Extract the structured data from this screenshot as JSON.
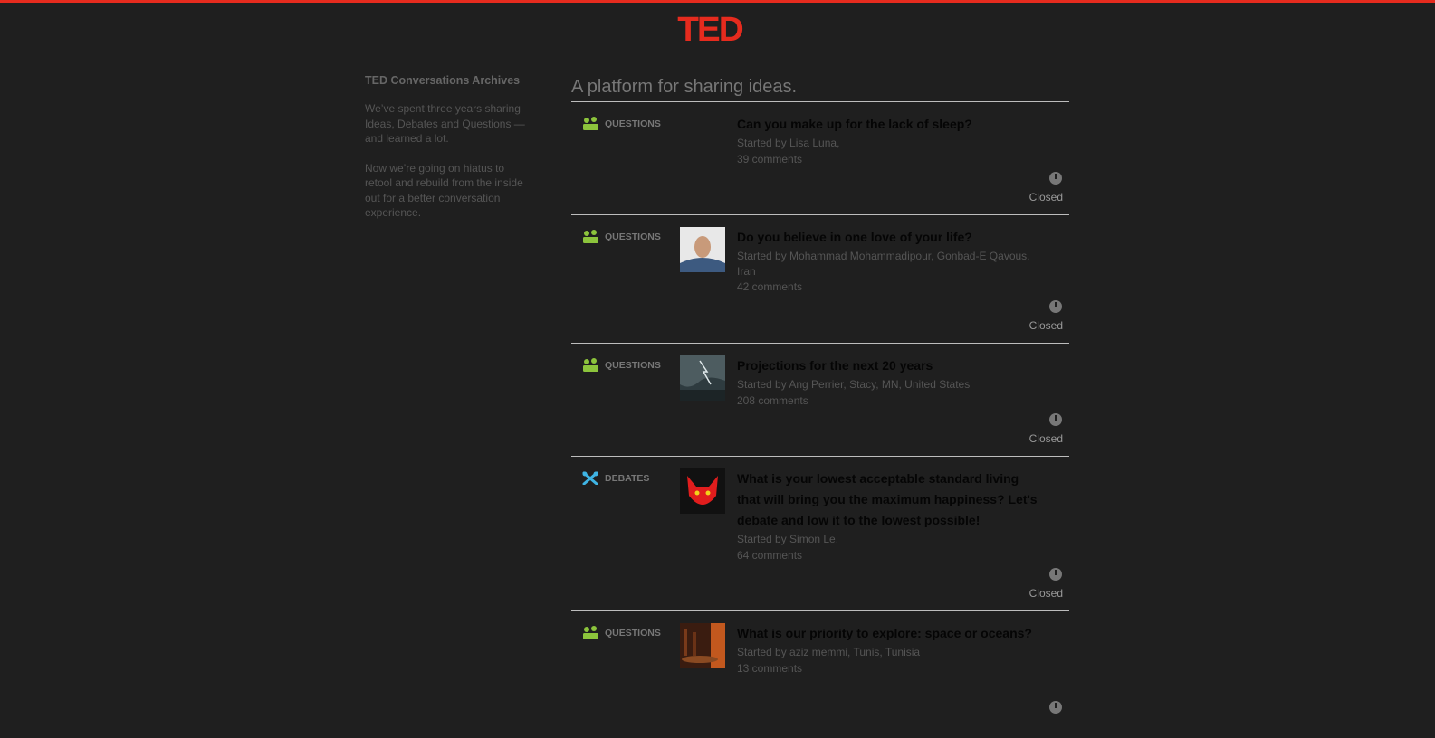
{
  "header": {
    "logo_text": "TED",
    "accent_color": "#e62b1e"
  },
  "sidebar": {
    "title": "TED Conversations Archives",
    "paragraphs": [
      "We’ve spent three years sharing Ideas, Debates and Questions — and learned a lot.",
      "Now we’re going on hiatus to retool and rebuild from the inside out for a better conversation experience."
    ]
  },
  "main": {
    "tagline": "A platform for sharing ideas.",
    "items": [
      {
        "type": "QUESTIONS",
        "icon": "questions-icon",
        "title": "Can you make up for the lack of sleep?",
        "started_by": "Started by Lisa Luna,",
        "comments": "39 comments",
        "status": "Closed"
      },
      {
        "type": "QUESTIONS",
        "icon": "questions-icon",
        "title": "Do you believe in one love of your life?",
        "started_by": "Started by Mohammad Mohammadipour, Gonbad-E Qavous, Iran",
        "comments": "42 comments",
        "status": "Closed"
      },
      {
        "type": "QUESTIONS",
        "icon": "questions-icon",
        "title": "Projections for the next 20 years",
        "started_by": "Started by Ang Perrier, Stacy, MN, United States",
        "comments": "208 comments",
        "status": "Closed"
      },
      {
        "type": "DEBATES",
        "icon": "debates-icon",
        "title": "What is your lowest acceptable standard living that will bring you the maximum happiness? Let's debate and low it to the lowest possible!",
        "started_by": "Started by Simon Le,",
        "comments": "64 comments",
        "status": "Closed"
      },
      {
        "type": "QUESTIONS",
        "icon": "questions-icon",
        "title": "What is our priority to explore: space or oceans?",
        "started_by": "Started by aziz memmi, Tunis, Tunisia",
        "comments": "13 comments",
        "status": ""
      }
    ]
  }
}
